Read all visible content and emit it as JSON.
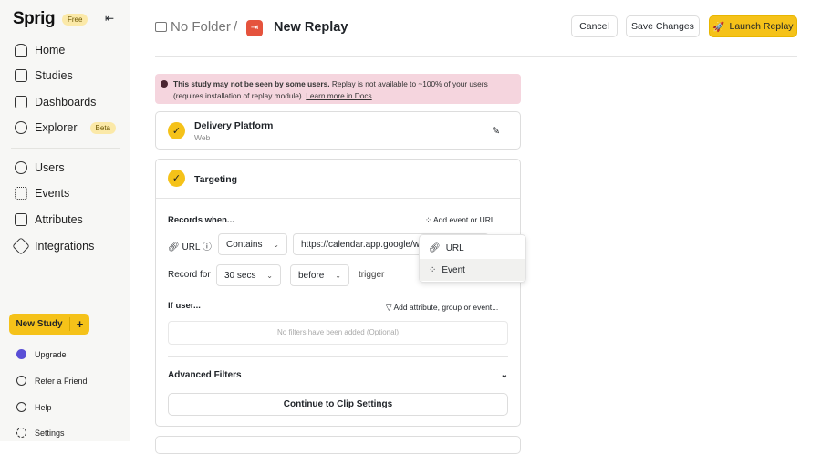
{
  "sidebar": {
    "logo": "Sprig",
    "plan_badge": "Free",
    "nav": [
      {
        "label": "Home",
        "icon": "home-icon"
      },
      {
        "label": "Studies",
        "icon": "studies-icon"
      },
      {
        "label": "Dashboards",
        "icon": "dashboards-icon"
      },
      {
        "label": "Explorer",
        "icon": "explorer-icon",
        "badge": "Beta"
      },
      {
        "label": "Users",
        "icon": "users-icon"
      },
      {
        "label": "Events",
        "icon": "events-icon"
      },
      {
        "label": "Attributes",
        "icon": "attributes-icon"
      },
      {
        "label": "Integrations",
        "icon": "integrations-icon"
      }
    ],
    "new_study": "New Study",
    "bottom": [
      {
        "label": "Upgrade"
      },
      {
        "label": "Refer a Friend"
      },
      {
        "label": "Help"
      },
      {
        "label": "Settings"
      }
    ]
  },
  "header": {
    "folder": "No Folder",
    "separator": "/",
    "title": "New Replay",
    "cancel": "Cancel",
    "save": "Save Changes",
    "launch": "Launch Replay"
  },
  "alert": {
    "bold": "This study may not be seen by some users.",
    "text": " Replay is not available to ~100% of your users (requires installation of replay module). ",
    "link": "Learn more in Docs"
  },
  "platform": {
    "title": "Delivery Platform",
    "sub": "Web"
  },
  "targeting": {
    "title": "Targeting",
    "records_when": "Records when...",
    "add_event": "Add event or URL...",
    "url_label": "URL",
    "match": "Contains",
    "url_value": "https://calendar.app.google/wfx",
    "record_for": "Record for",
    "duration": "30 secs",
    "timing": "before",
    "trigger": "trigger",
    "if_user": "If user...",
    "add_attr": "Add attribute, group or event...",
    "no_filters": "No filters have been added (Optional)",
    "advanced": "Advanced Filters",
    "continue": "Continue to Clip Settings"
  },
  "dropdown": {
    "items": [
      "URL",
      "Event"
    ]
  },
  "colors": {
    "accent": "#f5c219",
    "alert_bg": "#f5d5de"
  }
}
